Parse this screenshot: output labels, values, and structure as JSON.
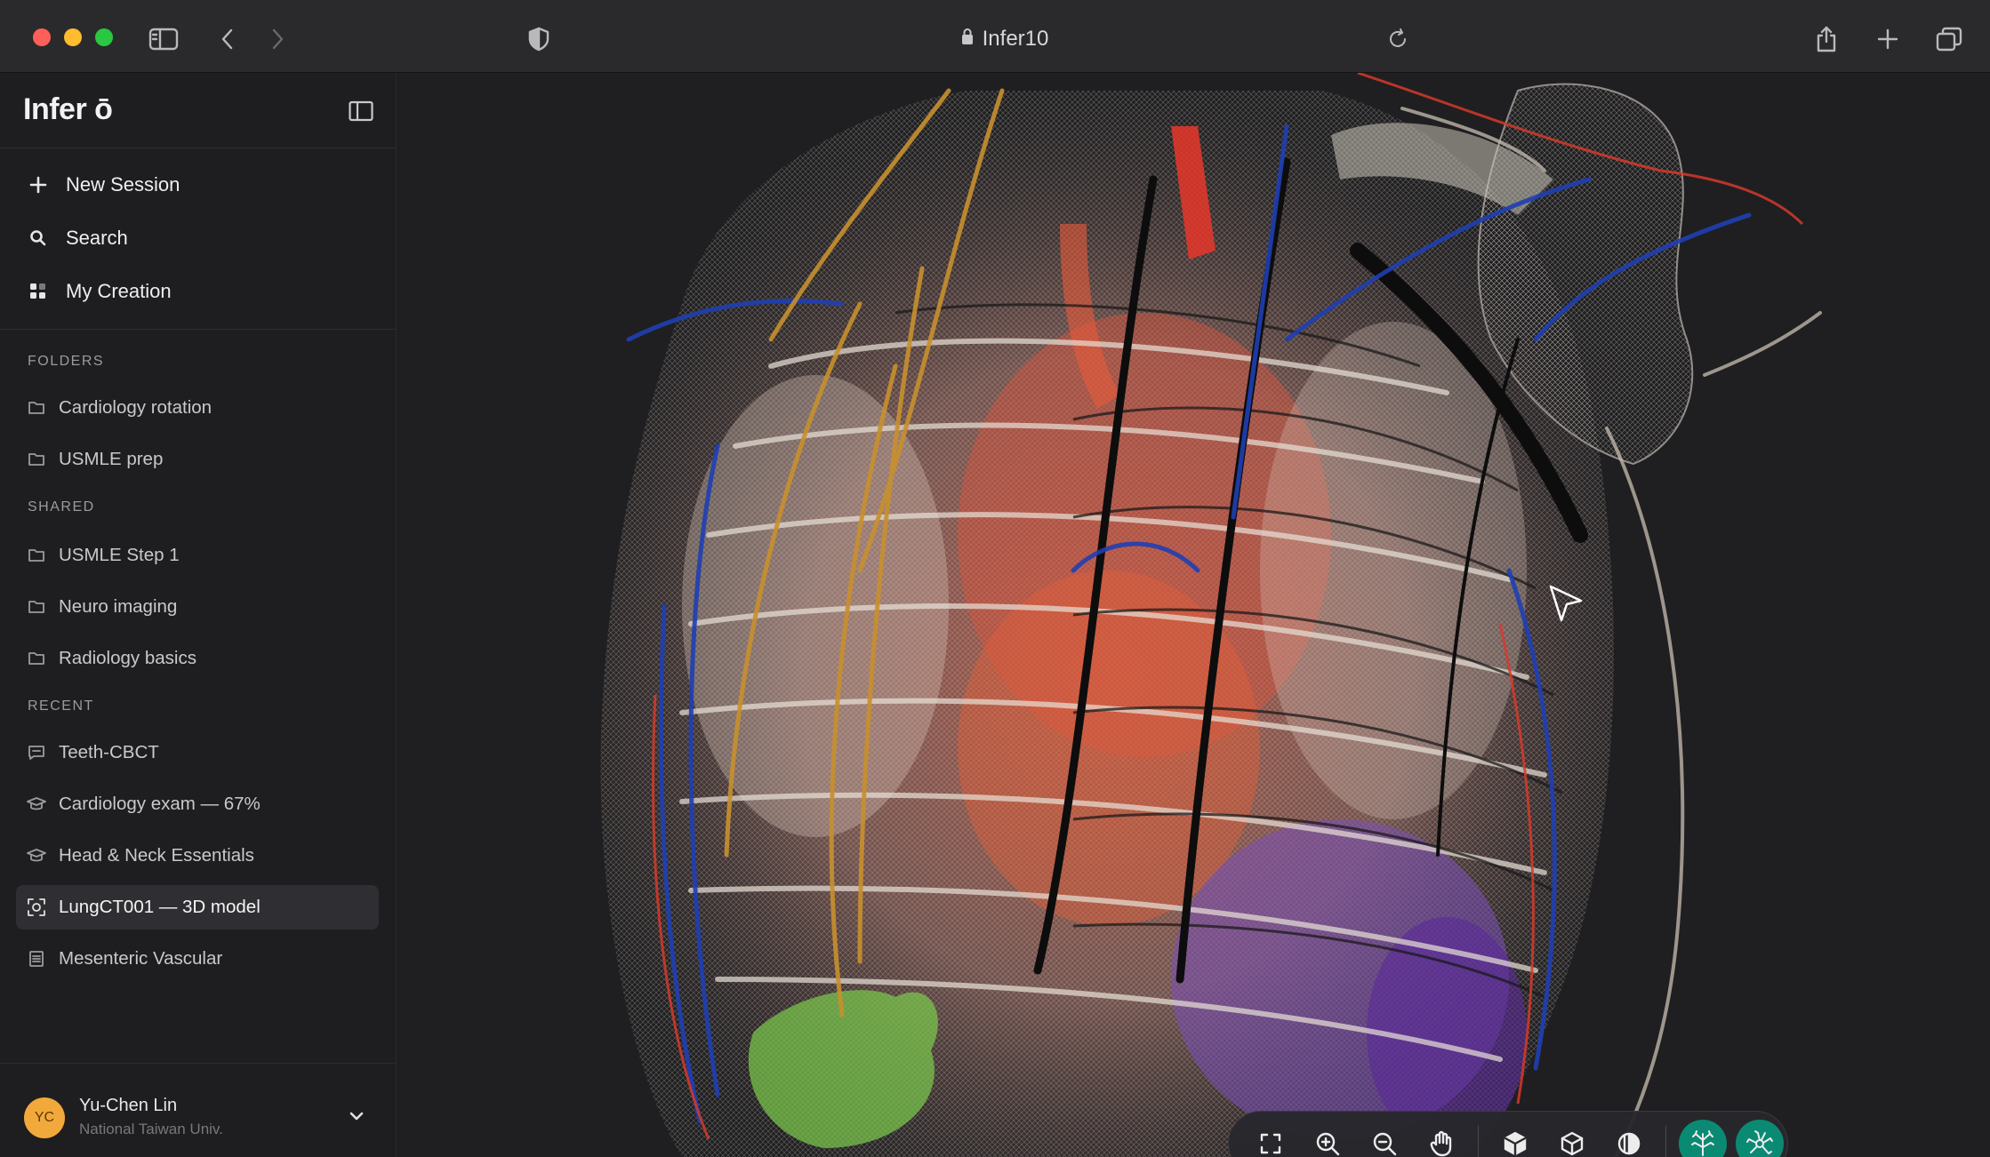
{
  "browser": {
    "url_text": "Infer10",
    "icons": [
      "sidebar-toggle-icon",
      "back-icon",
      "forward-icon",
      "shield-icon",
      "lock-icon",
      "reload-icon",
      "share-icon",
      "new-tab-icon",
      "tabs-overview-icon"
    ]
  },
  "sidebar": {
    "brand": "Infer ō",
    "nav": [
      {
        "label": "New Session",
        "icon": "plus-icon"
      },
      {
        "label": "Search",
        "icon": "search-icon"
      },
      {
        "label": "My Creation",
        "icon": "grid-icon"
      }
    ],
    "folders_label": "FOLDERS",
    "folders": [
      "Cardiology rotation",
      "USMLE prep"
    ],
    "shared_label": "SHARED",
    "shared": [
      "USMLE Step 1",
      "Neuro imaging",
      "Radiology basics"
    ],
    "recent_label": "RECENT",
    "recent": [
      {
        "label": "Teeth-CBCT",
        "icon": "chat-icon"
      },
      {
        "label": "Cardiology exam — 67%",
        "icon": "graduation-cap-icon"
      },
      {
        "label": "Head & Neck Essentials",
        "icon": "graduation-cap-icon"
      },
      {
        "label": "LungCT001 — 3D model",
        "icon": "scan-3d-icon",
        "active": true
      },
      {
        "label": "Mesenteric Vascular",
        "icon": "document-list-icon"
      }
    ],
    "user": {
      "initials": "YC",
      "name": "Yu-Chen Lin",
      "org": "National Taiwan Univ."
    }
  },
  "toolbar": {
    "tools": [
      {
        "name": "fullscreen-icon",
        "active": false
      },
      {
        "name": "zoom-in-icon",
        "active": false
      },
      {
        "name": "zoom-out-icon",
        "active": false
      },
      {
        "name": "pan-hand-icon",
        "active": false
      },
      {
        "name": "solid-cube-icon",
        "active": false
      },
      {
        "name": "wireframe-cube-icon",
        "active": false
      },
      {
        "name": "contrast-icon",
        "active": false
      },
      {
        "name": "vessel-tree-icon",
        "active": true
      },
      {
        "name": "nerve-network-icon",
        "active": true
      }
    ]
  },
  "colors": {
    "accent": "#0b8a73",
    "sidebar_bg": "#1e1e20",
    "viewer_bg": "#1f1f21",
    "avatar": "#f2a93b"
  }
}
